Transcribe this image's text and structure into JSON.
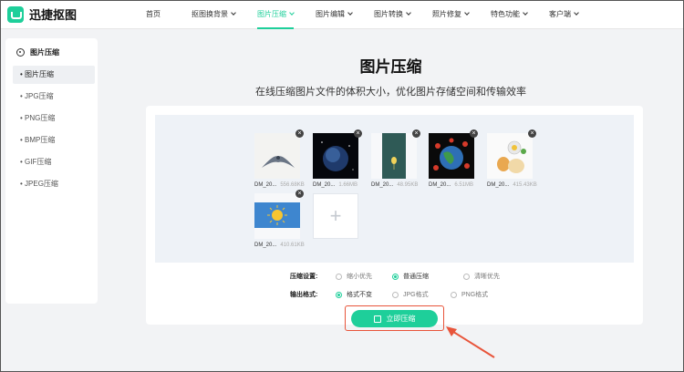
{
  "brand": {
    "name": "迅捷抠图",
    "accent": "#1ecf9a"
  },
  "nav": {
    "items": [
      {
        "label": "首页",
        "has_caret": false,
        "active": false
      },
      {
        "label": "抠图换背景",
        "has_caret": true,
        "active": false
      },
      {
        "label": "图片压缩",
        "has_caret": true,
        "active": true
      },
      {
        "label": "图片编辑",
        "has_caret": true,
        "active": false
      },
      {
        "label": "图片转换",
        "has_caret": true,
        "active": false
      },
      {
        "label": "照片修复",
        "has_caret": true,
        "active": false
      },
      {
        "label": "特色功能",
        "has_caret": true,
        "active": false
      },
      {
        "label": "客户端",
        "has_caret": true,
        "active": false
      }
    ]
  },
  "sidebar": {
    "header": "图片压缩",
    "items": [
      {
        "label": "图片压缩",
        "active": true
      },
      {
        "label": "JPG压缩",
        "active": false
      },
      {
        "label": "PNG压缩",
        "active": false
      },
      {
        "label": "BMP压缩",
        "active": false
      },
      {
        "label": "GIF压缩",
        "active": false
      },
      {
        "label": "JPEG压缩",
        "active": false
      }
    ]
  },
  "main": {
    "title": "图片压缩",
    "subtitle": "在线压缩图片文件的体积大小，优化图片存储空间和传输效率"
  },
  "files": [
    {
      "name": "DM_20...",
      "size": "556.68KB",
      "icon": "bird-icon"
    },
    {
      "name": "DM_20...",
      "size": "1.66MB",
      "icon": "planet-icon"
    },
    {
      "name": "DM_20...",
      "size": "48.95KB",
      "icon": "balloon-icon"
    },
    {
      "name": "DM_20...",
      "size": "6.51MB",
      "icon": "globe-icon"
    },
    {
      "name": "DM_20...",
      "size": "415.43KB",
      "icon": "food-icon"
    },
    {
      "name": "DM_20...",
      "size": "410.61KB",
      "icon": "sun-icon"
    }
  ],
  "add_button": {
    "symbol": "+"
  },
  "settings": {
    "compress_label": "压缩设置:",
    "compress_options": [
      {
        "label": "缩小优先",
        "selected": false
      },
      {
        "label": "普通压缩",
        "selected": true
      },
      {
        "label": "清晰优先",
        "selected": false
      }
    ],
    "format_label": "输出格式:",
    "format_options": [
      {
        "label": "格式不变",
        "selected": true
      },
      {
        "label": "JPG格式",
        "selected": false
      },
      {
        "label": "PNG格式",
        "selected": false
      }
    ]
  },
  "cta": {
    "label": "立即压缩"
  },
  "close_symbol": "×",
  "colors": {
    "accent": "#1ecf9a",
    "highlight": "#e8543a"
  }
}
